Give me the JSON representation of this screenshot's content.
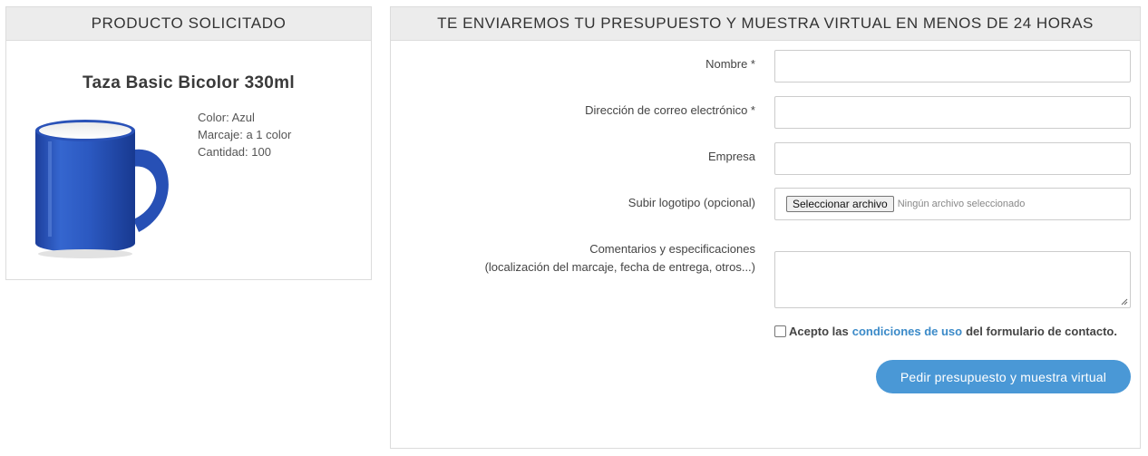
{
  "product_panel": {
    "header": "PRODUCTO SOLICITADO",
    "title": "Taza Basic Bicolor 330ml",
    "details": [
      "Color: Azul",
      "Marcaje: a 1 color",
      "Cantidad: 100"
    ],
    "image_icon": "blue-mug-image",
    "mug_color": "#2a52b8"
  },
  "form_panel": {
    "header": "TE ENVIAREMOS TU PRESUPUESTO Y MUESTRA VIRTUAL EN MENOS DE 24 HORAS",
    "fields": {
      "name_label": "Nombre *",
      "name_value": "",
      "email_label": "Dirección de correo electrónico *",
      "email_value": "",
      "company_label": "Empresa",
      "company_value": "",
      "logo_label": "Subir logotipo (opcional)",
      "logo_button": "Seleccionar archivo",
      "logo_status": "Ningún archivo seleccionado",
      "comments_label_line1": "Comentarios y especificaciones",
      "comments_label_line2": "(localización del marcaje, fecha de entrega, otros...)",
      "comments_value": ""
    },
    "accept": {
      "prefix": "Acepto las",
      "link": "condiciones de uso",
      "suffix": "del formulario de contacto.",
      "checked": false
    },
    "submit_label": "Pedir presupuesto y muestra virtual"
  },
  "colors": {
    "accent": "#4a98d6",
    "link": "#3b8ac8",
    "header_bg": "#ececec",
    "border": "#dcdcdc"
  }
}
